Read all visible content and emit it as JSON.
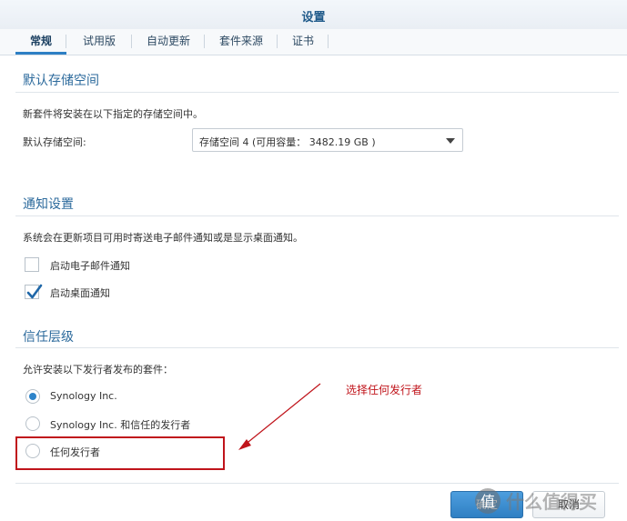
{
  "window": {
    "title": "设置"
  },
  "tabs": [
    {
      "label": "常规",
      "active": true
    },
    {
      "label": "试用版"
    },
    {
      "label": "自动更新"
    },
    {
      "label": "套件来源"
    },
    {
      "label": "证书"
    }
  ],
  "storage": {
    "section_title": "默认存储空间",
    "description": "新套件将安装在以下指定的存储空间中。",
    "field_label": "默认存储空间:",
    "selected_value": "存储空间 4 (可用容量： 3482.19 GB )"
  },
  "notification": {
    "section_title": "通知设置",
    "description": "系统会在更新项目可用时寄送电子邮件通知或是显示桌面通知。",
    "options": [
      {
        "label": "启动电子邮件通知",
        "checked": false
      },
      {
        "label": "启动桌面通知",
        "checked": true
      }
    ]
  },
  "trust": {
    "section_title": "信任层级",
    "description": "允许安装以下发行者发布的套件：",
    "options": [
      {
        "label": "Synology Inc.",
        "selected": true
      },
      {
        "label": "Synology Inc. 和信任的发行者",
        "selected": false
      },
      {
        "label": "任何发行者",
        "selected": false
      }
    ]
  },
  "annotation": {
    "text": "选择任何发行者",
    "color": "#c0141b"
  },
  "footer": {
    "ok_label": "确定",
    "cancel_label": "取消"
  },
  "watermark": {
    "text": "什么值得买"
  },
  "colors": {
    "accent": "#2d7fc4",
    "title": "#1f5a8a",
    "annotation": "#c0141b"
  }
}
